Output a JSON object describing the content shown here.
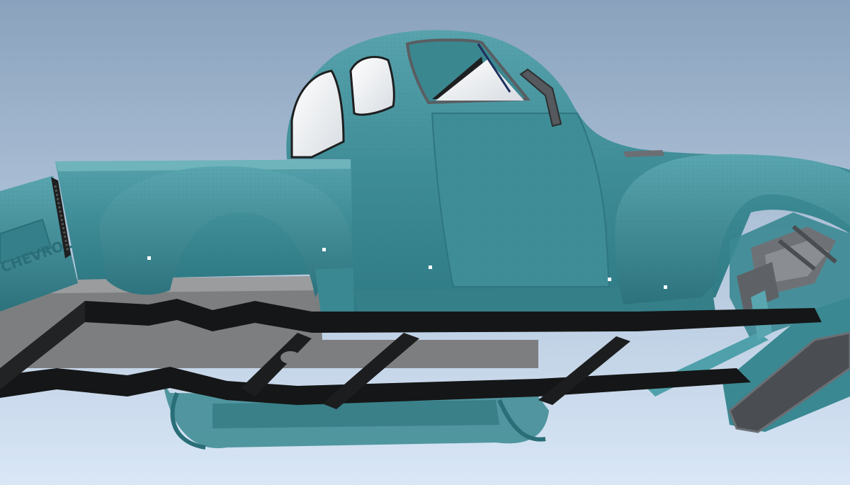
{
  "viewport": {
    "background_top": "#8aa2bd",
    "background_bottom": "#d9e7f7"
  },
  "model": {
    "body_color": "#3f8d97",
    "body_highlight": "#6fb3bb",
    "body_shadow": "#2a6e78",
    "frame_color": "#151617",
    "glass_color": "#eef2f5",
    "chrome_color": "#6b6f74",
    "tailgate_text": "CHEVROLET"
  }
}
